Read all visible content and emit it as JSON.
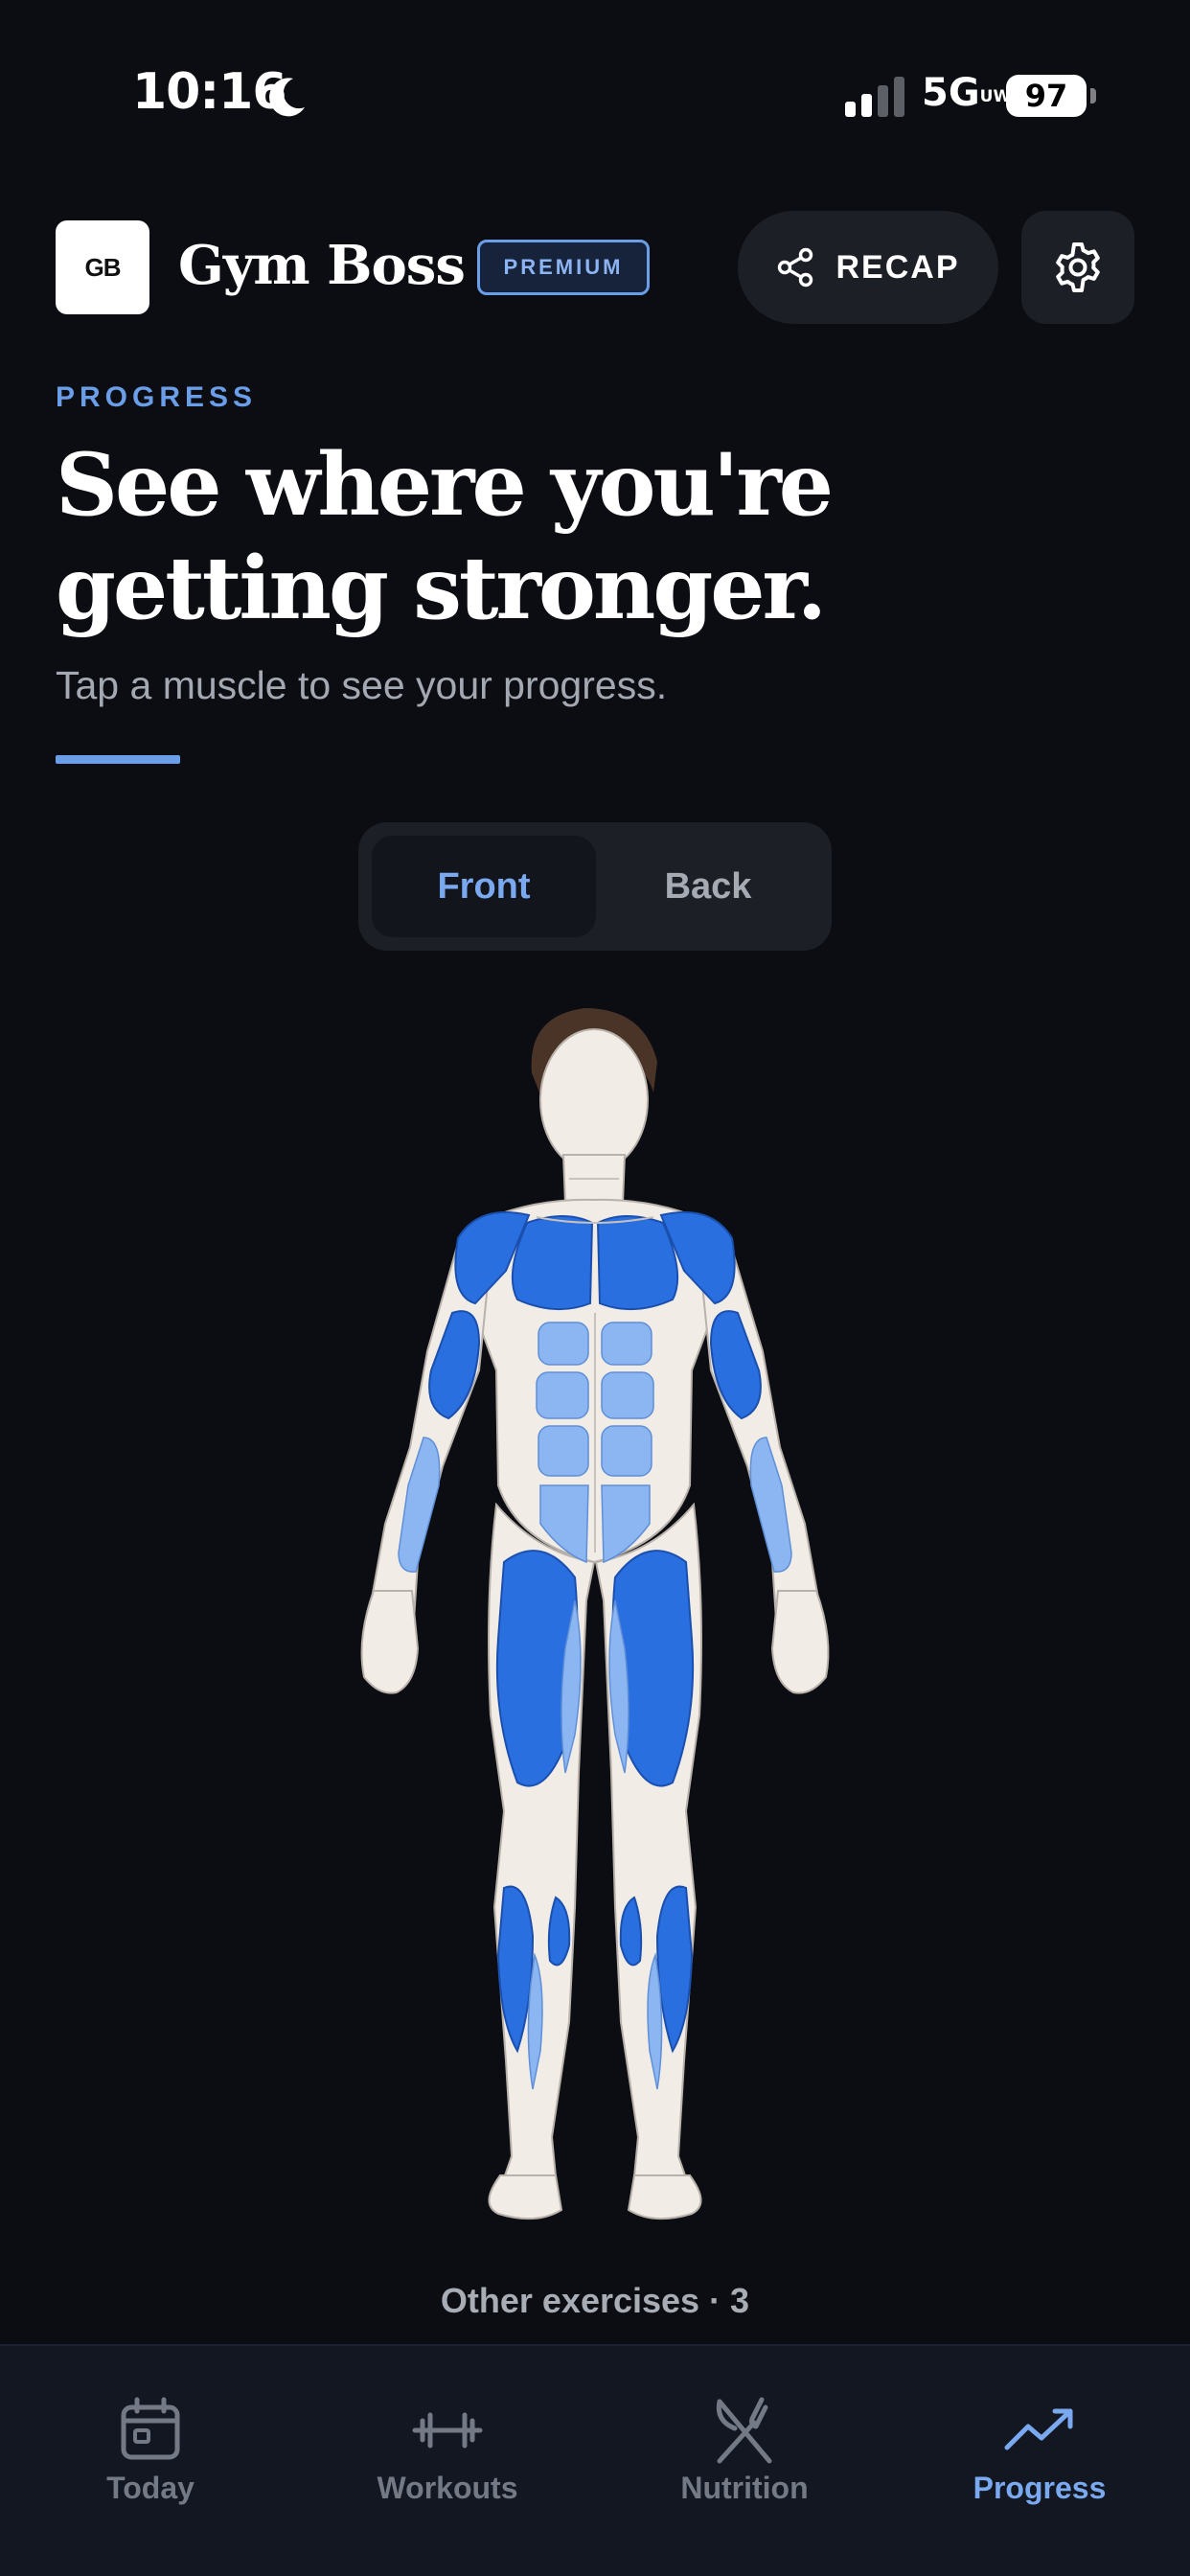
{
  "status_bar": {
    "time": "10:16",
    "network": "5G",
    "network_suffix": "UW",
    "battery": "97"
  },
  "header": {
    "logo_text": "GB",
    "app_name": "Gym Boss",
    "badge": "PREMIUM",
    "recap_label": "RECAP"
  },
  "intro": {
    "eyebrow": "PROGRESS",
    "headline": "See where you're getting stronger.",
    "subtext": "Tap a muscle to see your progress."
  },
  "view_toggle": {
    "options": [
      "Front",
      "Back"
    ],
    "selected": "Front"
  },
  "other_exercises": "Other exercises · 3",
  "tabs": [
    {
      "label": "Today",
      "icon": "calendar-icon",
      "active": false
    },
    {
      "label": "Workouts",
      "icon": "dumbbell-icon",
      "active": false
    },
    {
      "label": "Nutrition",
      "icon": "fork-knife-icon",
      "active": false
    },
    {
      "label": "Progress",
      "icon": "trend-up-icon",
      "active": true
    }
  ],
  "colors": {
    "background": "#0b0d12",
    "accent": "#6b9ee8",
    "muscle_primary": "#2a6fe0",
    "muscle_secondary": "#8cb6f2",
    "skin": "#f1ece6"
  }
}
